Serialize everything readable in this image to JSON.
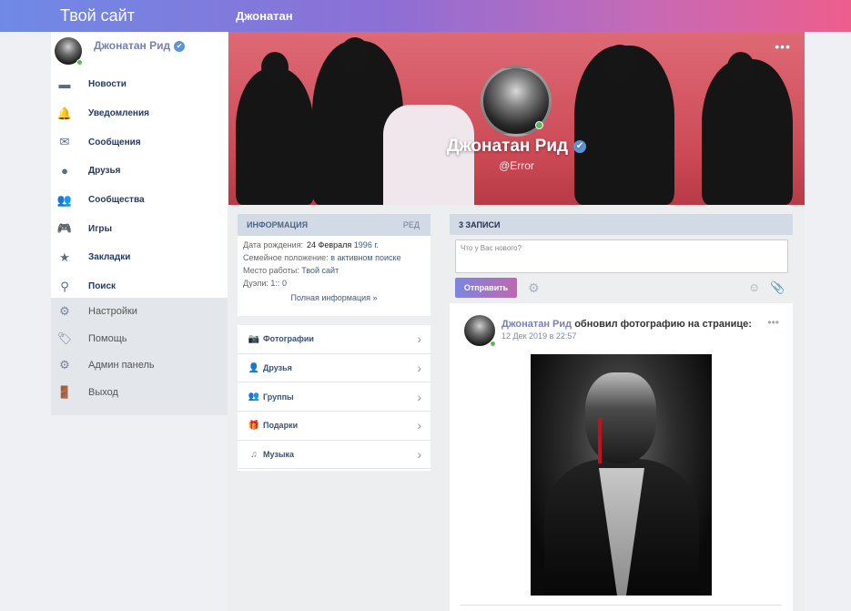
{
  "header": {
    "site_title": "Твой сайт",
    "page_name": "Джонатан"
  },
  "sidebar": {
    "profile_name": "Джонатан Рид",
    "verified_glyph": "✔",
    "items": [
      {
        "label": "Новости",
        "icon": "news-icon",
        "glyph": "▬"
      },
      {
        "label": "Уведомления",
        "icon": "bell-icon",
        "glyph": "🔔"
      },
      {
        "label": "Сообщения",
        "icon": "envelope-icon",
        "glyph": "✉"
      },
      {
        "label": "Друзья",
        "icon": "user-icon",
        "glyph": "●"
      },
      {
        "label": "Сообщества",
        "icon": "users-icon",
        "glyph": "👥"
      },
      {
        "label": "Игры",
        "icon": "gamepad-icon",
        "glyph": "🎮"
      },
      {
        "label": "Закладки",
        "icon": "star-icon",
        "glyph": "★"
      },
      {
        "label": "Поиск",
        "icon": "search-icon",
        "glyph": "⚲"
      }
    ],
    "sub_items": [
      {
        "label": "Настройки",
        "icon": "gear-icon",
        "glyph": "⚙"
      },
      {
        "label": "Помощь",
        "icon": "tag-icon",
        "glyph": "🏷"
      },
      {
        "label": "Админ панель",
        "icon": "cogs-icon",
        "glyph": "⚙"
      },
      {
        "label": "Выход",
        "icon": "door-icon",
        "glyph": "🚪"
      }
    ]
  },
  "cover": {
    "name": "Джонатан Рид",
    "handle": "@Error",
    "menu": "•••",
    "verified_glyph": "✔"
  },
  "info": {
    "title": "ИНФОРМАЦИЯ",
    "edit": "РЕД",
    "birth_label": "Дата рождения:",
    "birth_date": "24 Февраля",
    "birth_year": "1996 г.",
    "family_label": "Семейное положение:",
    "family_value": "в активном поиске",
    "work_label": "Место работы:",
    "work_value": "Твой сайт",
    "duels_label": "Дуэли:",
    "duels_wins": "1",
    "duels_sep": "::",
    "duels_losses": "0",
    "full": "Полная информация »"
  },
  "links": [
    {
      "label": "Фотографии",
      "icon": "camera-icon",
      "glyph": "📷"
    },
    {
      "label": "Друзья",
      "icon": "friends-icon",
      "glyph": "👤"
    },
    {
      "label": "Группы",
      "icon": "groups-icon",
      "glyph": "👥"
    },
    {
      "label": "Подарки",
      "icon": "gift-icon",
      "glyph": "🎁"
    },
    {
      "label": "Музыка",
      "icon": "music-icon",
      "glyph": "♫"
    }
  ],
  "wall": {
    "title": "3 ЗАПИСИ",
    "placeholder": "Что у Вас нового?",
    "send": "Отправить",
    "gear_glyph": "⚙",
    "emoji_glyph": "☺",
    "clip_glyph": "📎"
  },
  "post": {
    "author": "Джонатан Рид",
    "action": "обновил фотографию на странице:",
    "date": "12 Дек 2019 в 22:57",
    "menu": "•••"
  }
}
